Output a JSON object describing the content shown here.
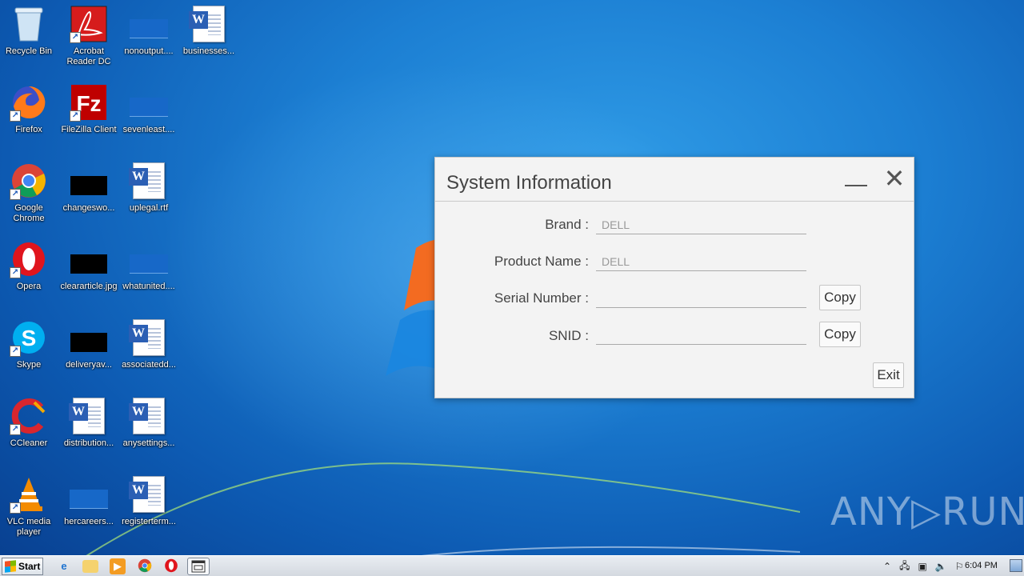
{
  "desktop": {
    "icons": [
      {
        "label": "Recycle Bin"
      },
      {
        "label": "Acrobat Reader DC"
      },
      {
        "label": "nonoutput...."
      },
      {
        "label": "businesses..."
      },
      {
        "label": "Firefox"
      },
      {
        "label": "FileZilla Client"
      },
      {
        "label": "sevenleast...."
      },
      {
        "label": "Google Chrome"
      },
      {
        "label": "changeswo..."
      },
      {
        "label": "uplegal.rtf"
      },
      {
        "label": "Opera"
      },
      {
        "label": "cleararticle.jpg"
      },
      {
        "label": "whatunited...."
      },
      {
        "label": "Skype"
      },
      {
        "label": "deliveryav..."
      },
      {
        "label": "associatedd..."
      },
      {
        "label": "CCleaner"
      },
      {
        "label": "distribution..."
      },
      {
        "label": "anysettings..."
      },
      {
        "label": "VLC media player"
      },
      {
        "label": "hercareers..."
      },
      {
        "label": "registerterm..."
      }
    ]
  },
  "dialog": {
    "title": "System Information",
    "close_glyph": "✕",
    "fields": [
      {
        "label": "Brand :",
        "value": "DELL"
      },
      {
        "label": "Product Name :",
        "value": "DELL"
      },
      {
        "label": "Serial Number :",
        "value": ""
      },
      {
        "label": "SNID :",
        "value": ""
      }
    ],
    "copy_label": "Copy",
    "exit_label": "Exit"
  },
  "taskbar": {
    "start_label": "Start",
    "clock": "6:04 PM"
  },
  "watermark": "ANY▷RUN",
  "colors": {
    "desktop_blue": "#1c7fd3",
    "dialog_bg": "#f3f3f3",
    "taskbar_bg": "#d4d9e0"
  }
}
